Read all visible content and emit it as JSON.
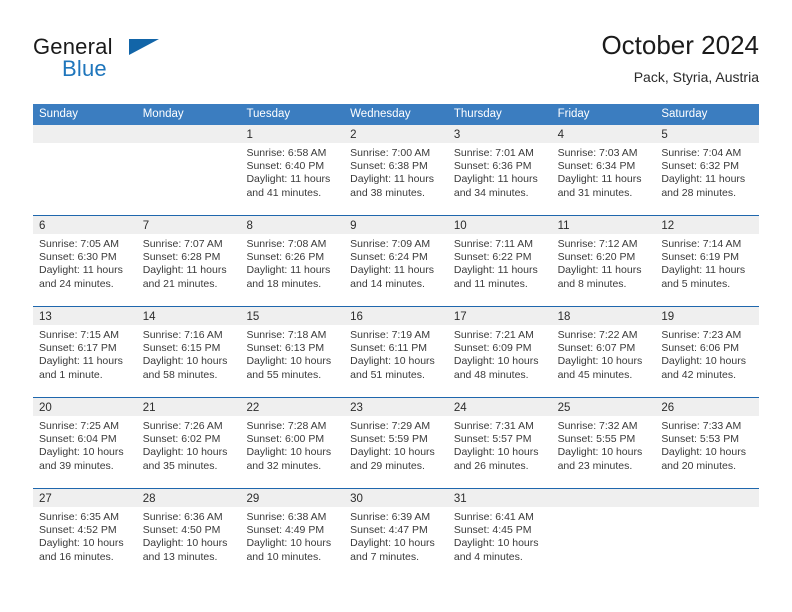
{
  "brand": {
    "word_one": "General",
    "word_two": "Blue",
    "logo_icon": "triangle-logo-icon"
  },
  "header": {
    "title": "October 2024",
    "subtitle": "Pack, Styria, Austria"
  },
  "colors": {
    "header_blue": "#3b7dc0",
    "rule_blue": "#1f67ad",
    "band_gray": "#efefef",
    "brand_blue": "#1f76bc"
  },
  "weekdays": [
    "Sunday",
    "Monday",
    "Tuesday",
    "Wednesday",
    "Thursday",
    "Friday",
    "Saturday"
  ],
  "weeks": [
    [
      {
        "day": "",
        "lines": []
      },
      {
        "day": "",
        "lines": []
      },
      {
        "day": "1",
        "lines": [
          "Sunrise: 6:58 AM",
          "Sunset: 6:40 PM",
          "Daylight: 11 hours",
          "and 41 minutes."
        ]
      },
      {
        "day": "2",
        "lines": [
          "Sunrise: 7:00 AM",
          "Sunset: 6:38 PM",
          "Daylight: 11 hours",
          "and 38 minutes."
        ]
      },
      {
        "day": "3",
        "lines": [
          "Sunrise: 7:01 AM",
          "Sunset: 6:36 PM",
          "Daylight: 11 hours",
          "and 34 minutes."
        ]
      },
      {
        "day": "4",
        "lines": [
          "Sunrise: 7:03 AM",
          "Sunset: 6:34 PM",
          "Daylight: 11 hours",
          "and 31 minutes."
        ]
      },
      {
        "day": "5",
        "lines": [
          "Sunrise: 7:04 AM",
          "Sunset: 6:32 PM",
          "Daylight: 11 hours",
          "and 28 minutes."
        ]
      }
    ],
    [
      {
        "day": "6",
        "lines": [
          "Sunrise: 7:05 AM",
          "Sunset: 6:30 PM",
          "Daylight: 11 hours",
          "and 24 minutes."
        ]
      },
      {
        "day": "7",
        "lines": [
          "Sunrise: 7:07 AM",
          "Sunset: 6:28 PM",
          "Daylight: 11 hours",
          "and 21 minutes."
        ]
      },
      {
        "day": "8",
        "lines": [
          "Sunrise: 7:08 AM",
          "Sunset: 6:26 PM",
          "Daylight: 11 hours",
          "and 18 minutes."
        ]
      },
      {
        "day": "9",
        "lines": [
          "Sunrise: 7:09 AM",
          "Sunset: 6:24 PM",
          "Daylight: 11 hours",
          "and 14 minutes."
        ]
      },
      {
        "day": "10",
        "lines": [
          "Sunrise: 7:11 AM",
          "Sunset: 6:22 PM",
          "Daylight: 11 hours",
          "and 11 minutes."
        ]
      },
      {
        "day": "11",
        "lines": [
          "Sunrise: 7:12 AM",
          "Sunset: 6:20 PM",
          "Daylight: 11 hours",
          "and 8 minutes."
        ]
      },
      {
        "day": "12",
        "lines": [
          "Sunrise: 7:14 AM",
          "Sunset: 6:19 PM",
          "Daylight: 11 hours",
          "and 5 minutes."
        ]
      }
    ],
    [
      {
        "day": "13",
        "lines": [
          "Sunrise: 7:15 AM",
          "Sunset: 6:17 PM",
          "Daylight: 11 hours",
          "and 1 minute."
        ]
      },
      {
        "day": "14",
        "lines": [
          "Sunrise: 7:16 AM",
          "Sunset: 6:15 PM",
          "Daylight: 10 hours",
          "and 58 minutes."
        ]
      },
      {
        "day": "15",
        "lines": [
          "Sunrise: 7:18 AM",
          "Sunset: 6:13 PM",
          "Daylight: 10 hours",
          "and 55 minutes."
        ]
      },
      {
        "day": "16",
        "lines": [
          "Sunrise: 7:19 AM",
          "Sunset: 6:11 PM",
          "Daylight: 10 hours",
          "and 51 minutes."
        ]
      },
      {
        "day": "17",
        "lines": [
          "Sunrise: 7:21 AM",
          "Sunset: 6:09 PM",
          "Daylight: 10 hours",
          "and 48 minutes."
        ]
      },
      {
        "day": "18",
        "lines": [
          "Sunrise: 7:22 AM",
          "Sunset: 6:07 PM",
          "Daylight: 10 hours",
          "and 45 minutes."
        ]
      },
      {
        "day": "19",
        "lines": [
          "Sunrise: 7:23 AM",
          "Sunset: 6:06 PM",
          "Daylight: 10 hours",
          "and 42 minutes."
        ]
      }
    ],
    [
      {
        "day": "20",
        "lines": [
          "Sunrise: 7:25 AM",
          "Sunset: 6:04 PM",
          "Daylight: 10 hours",
          "and 39 minutes."
        ]
      },
      {
        "day": "21",
        "lines": [
          "Sunrise: 7:26 AM",
          "Sunset: 6:02 PM",
          "Daylight: 10 hours",
          "and 35 minutes."
        ]
      },
      {
        "day": "22",
        "lines": [
          "Sunrise: 7:28 AM",
          "Sunset: 6:00 PM",
          "Daylight: 10 hours",
          "and 32 minutes."
        ]
      },
      {
        "day": "23",
        "lines": [
          "Sunrise: 7:29 AM",
          "Sunset: 5:59 PM",
          "Daylight: 10 hours",
          "and 29 minutes."
        ]
      },
      {
        "day": "24",
        "lines": [
          "Sunrise: 7:31 AM",
          "Sunset: 5:57 PM",
          "Daylight: 10 hours",
          "and 26 minutes."
        ]
      },
      {
        "day": "25",
        "lines": [
          "Sunrise: 7:32 AM",
          "Sunset: 5:55 PM",
          "Daylight: 10 hours",
          "and 23 minutes."
        ]
      },
      {
        "day": "26",
        "lines": [
          "Sunrise: 7:33 AM",
          "Sunset: 5:53 PM",
          "Daylight: 10 hours",
          "and 20 minutes."
        ]
      }
    ],
    [
      {
        "day": "27",
        "lines": [
          "Sunrise: 6:35 AM",
          "Sunset: 4:52 PM",
          "Daylight: 10 hours",
          "and 16 minutes."
        ]
      },
      {
        "day": "28",
        "lines": [
          "Sunrise: 6:36 AM",
          "Sunset: 4:50 PM",
          "Daylight: 10 hours",
          "and 13 minutes."
        ]
      },
      {
        "day": "29",
        "lines": [
          "Sunrise: 6:38 AM",
          "Sunset: 4:49 PM",
          "Daylight: 10 hours",
          "and 10 minutes."
        ]
      },
      {
        "day": "30",
        "lines": [
          "Sunrise: 6:39 AM",
          "Sunset: 4:47 PM",
          "Daylight: 10 hours",
          "and 7 minutes."
        ]
      },
      {
        "day": "31",
        "lines": [
          "Sunrise: 6:41 AM",
          "Sunset: 4:45 PM",
          "Daylight: 10 hours",
          "and 4 minutes."
        ]
      },
      {
        "day": "",
        "lines": []
      },
      {
        "day": "",
        "lines": []
      }
    ]
  ]
}
